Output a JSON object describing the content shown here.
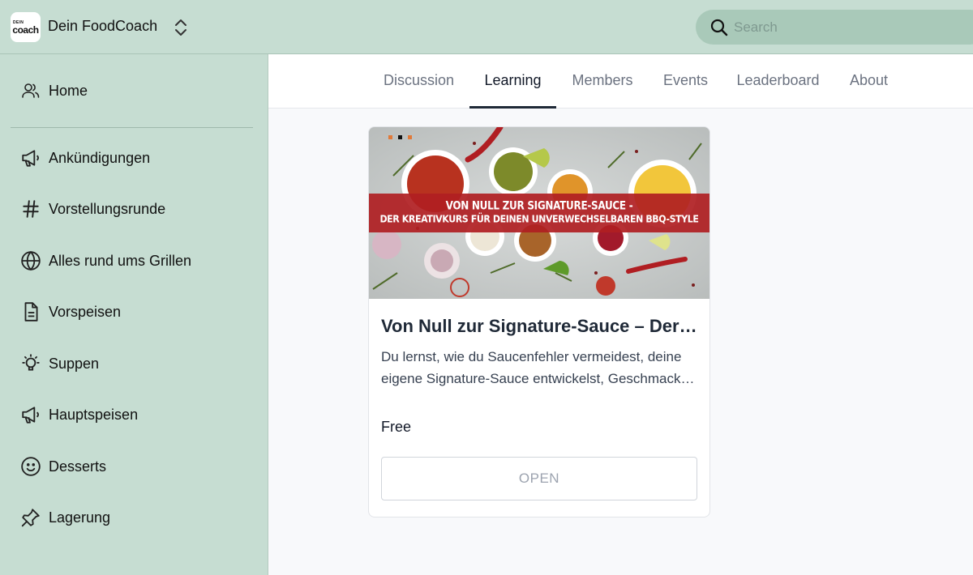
{
  "app": {
    "logo_small": "DEIN",
    "logo_big": "coach",
    "title": "Dein FoodCoach"
  },
  "search": {
    "placeholder": "Search"
  },
  "sidebar": {
    "items": [
      {
        "label": "Home",
        "icon": "users-icon"
      },
      {
        "label": "Ankündigungen",
        "icon": "megaphone-icon"
      },
      {
        "label": "Vorstellungsrunde",
        "icon": "hashtag-icon"
      },
      {
        "label": "Alles rund ums Grillen",
        "icon": "globe-icon"
      },
      {
        "label": "Vorspeisen",
        "icon": "document-icon"
      },
      {
        "label": "Suppen",
        "icon": "lightbulb-icon"
      },
      {
        "label": "Hauptspeisen",
        "icon": "megaphone-icon"
      },
      {
        "label": "Desserts",
        "icon": "smiley-icon"
      },
      {
        "label": "Lagerung",
        "icon": "pin-icon"
      }
    ]
  },
  "tabs": [
    {
      "label": "Discussion",
      "active": false
    },
    {
      "label": "Learning",
      "active": true
    },
    {
      "label": "Members",
      "active": false
    },
    {
      "label": "Events",
      "active": false
    },
    {
      "label": "Leaderboard",
      "active": false
    },
    {
      "label": "About",
      "active": false
    }
  ],
  "course": {
    "banner_line1": "VON NULL ZUR SIGNATURE-SAUCE -",
    "banner_line2": "DER KREATIVKURS FÜR DEINEN UNVERWECHSELBAREN BBQ-STYLE",
    "title": "Von Null zur Signature-Sauce – Der Kreativkurs für deinen unverwechselbaren BBQ-Style",
    "description": "Du lernst, wie du Saucenfehler vermeidest, deine eigene Signature-Sauce entwickelst, Geschmack und Konsistenz gezielt steuerst",
    "price": "Free",
    "button_label": "OPEN"
  },
  "colors": {
    "chrome_green": "#c6ddd2",
    "search_bg": "#a9c9b9",
    "banner_red": "#b01e22",
    "active_tab": "#1f2937"
  }
}
